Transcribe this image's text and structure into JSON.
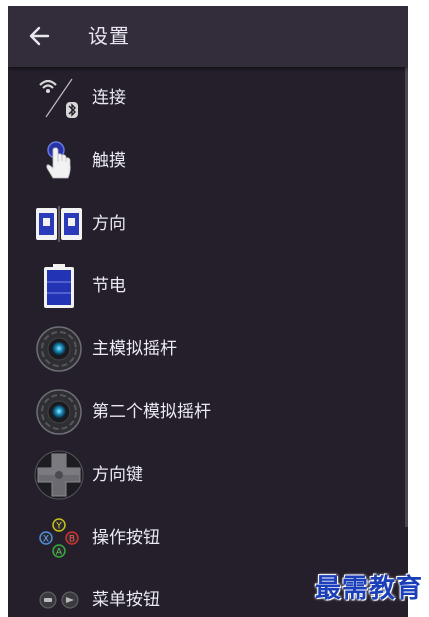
{
  "header": {
    "title": "设置"
  },
  "menu": [
    {
      "label": "连接",
      "icon": "wifi-bluetooth-icon"
    },
    {
      "label": "触摸",
      "icon": "touch-hand-icon"
    },
    {
      "label": "方向",
      "icon": "orientation-icon"
    },
    {
      "label": "节电",
      "icon": "battery-icon"
    },
    {
      "label": "主模拟摇杆",
      "icon": "joystick-icon"
    },
    {
      "label": "第二个模拟摇杆",
      "icon": "joystick-icon"
    },
    {
      "label": "方向键",
      "icon": "dpad-icon"
    },
    {
      "label": "操作按钮",
      "icon": "action-buttons-icon"
    },
    {
      "label": "菜单按钮",
      "icon": "menu-buttons-icon"
    }
  ],
  "watermark": "最需教育"
}
